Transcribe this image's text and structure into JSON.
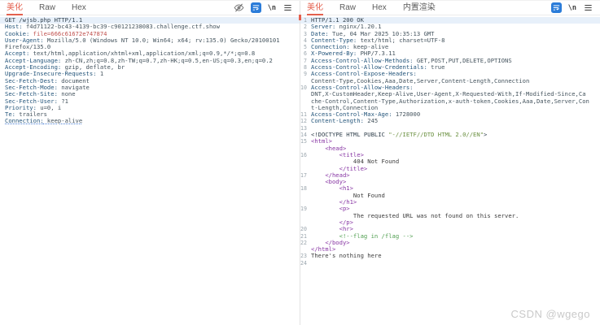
{
  "watermark": "CSDN @wgego",
  "colors": {
    "accent": "#e4604e",
    "wrap_icon_bg": "#2b7cd9",
    "line_highlight": "#e7f0fa"
  },
  "request_panel": {
    "tabs": [
      {
        "id": "pretty",
        "label": "美化",
        "active": true
      },
      {
        "id": "raw",
        "label": "Raw",
        "active": false
      },
      {
        "id": "hex",
        "label": "Hex",
        "active": false
      }
    ],
    "icons": [
      "hide-icon",
      "word-wrap-icon",
      "newline-icon",
      "menu-icon"
    ],
    "lines": [
      {
        "hl": true,
        "s": [
          [
            "GET /wjsb.php HTTP/1.1",
            "plain"
          ]
        ]
      },
      {
        "s": [
          [
            "Host:",
            "hname"
          ],
          [
            " f4d71122-bc43-4139-bc39-c90121238083.challenge.ctf.show",
            "hval"
          ]
        ]
      },
      {
        "s": [
          [
            "Cookie:",
            "hname"
          ],
          [
            " ",
            "hval"
          ],
          [
            "file=666c61672e747874",
            "red"
          ]
        ]
      },
      {
        "s": [
          [
            "User-Agent:",
            "hname"
          ],
          [
            " Mozilla/5.0 (Windows NT 10.0; Win64; x64; rv:135.0) Gecko/20100101",
            "hval"
          ]
        ]
      },
      {
        "s": [
          [
            "Firefox/135.0",
            "hval"
          ]
        ]
      },
      {
        "s": [
          [
            "Accept:",
            "hname"
          ],
          [
            " text/html,application/xhtml+xml,application/xml;q=0.9,*/*;q=0.8",
            "hval"
          ]
        ]
      },
      {
        "s": [
          [
            "Accept-Language:",
            "hname"
          ],
          [
            " zh-CN,zh;q=0.8,zh-TW;q=0.7,zh-HK;q=0.5,en-US;q=0.3,en;q=0.2",
            "hval"
          ]
        ]
      },
      {
        "s": [
          [
            "Accept-Encoding:",
            "hname"
          ],
          [
            " gzip, deflate, br",
            "hval"
          ]
        ]
      },
      {
        "s": [
          [
            "Upgrade-Insecure-Requests:",
            "hname"
          ],
          [
            " 1",
            "hval"
          ]
        ]
      },
      {
        "s": [
          [
            "Sec-Fetch-Dest:",
            "hname"
          ],
          [
            " document",
            "hval"
          ]
        ]
      },
      {
        "s": [
          [
            "Sec-Fetch-Mode:",
            "hname"
          ],
          [
            " navigate",
            "hval"
          ]
        ]
      },
      {
        "s": [
          [
            "Sec-Fetch-Site:",
            "hname"
          ],
          [
            " none",
            "hval"
          ]
        ]
      },
      {
        "s": [
          [
            "Sec-Fetch-User:",
            "hname"
          ],
          [
            " ?1",
            "hval"
          ]
        ]
      },
      {
        "s": [
          [
            "Priority:",
            "hname"
          ],
          [
            " u=0, i",
            "hval"
          ]
        ]
      },
      {
        "s": [
          [
            "Te:",
            "hname"
          ],
          [
            " trailers",
            "hval"
          ]
        ]
      },
      {
        "s": [
          [
            "Connection:",
            "uname"
          ],
          [
            " keep-alive",
            "uval"
          ]
        ]
      }
    ]
  },
  "response_panel": {
    "tabs": [
      {
        "id": "pretty",
        "label": "美化",
        "active": true
      },
      {
        "id": "raw",
        "label": "Raw",
        "active": false
      },
      {
        "id": "hex",
        "label": "Hex",
        "active": false
      },
      {
        "id": "render",
        "label": "内置渲染",
        "active": false
      }
    ],
    "icons": [
      "word-wrap-icon",
      "newline-icon",
      "menu-icon"
    ],
    "lines": [
      {
        "n": "1",
        "hl": true,
        "s": [
          [
            "HTTP/1.1 200 OK",
            "plain"
          ]
        ]
      },
      {
        "n": "2",
        "s": [
          [
            "Server:",
            "hname"
          ],
          [
            " nginx/1.20.1",
            "hval"
          ]
        ]
      },
      {
        "n": "3",
        "s": [
          [
            "Date:",
            "hname"
          ],
          [
            " Tue, 04 Mar 2025 10:35:13 GMT",
            "hval"
          ]
        ]
      },
      {
        "n": "4",
        "s": [
          [
            "Content-Type:",
            "hname"
          ],
          [
            " text/html; charset=UTF-8",
            "hval"
          ]
        ]
      },
      {
        "n": "5",
        "s": [
          [
            "Connection:",
            "hname"
          ],
          [
            " keep-alive",
            "hval"
          ]
        ]
      },
      {
        "n": "6",
        "s": [
          [
            "X-Powered-By:",
            "hname"
          ],
          [
            " PHP/7.3.11",
            "hval"
          ]
        ]
      },
      {
        "n": "7",
        "s": [
          [
            "Access-Control-Allow-Methods:",
            "hname"
          ],
          [
            " GET,POST,PUT,DELETE,OPTIONS",
            "hval"
          ]
        ]
      },
      {
        "n": "8",
        "s": [
          [
            "Access-Control-Allow-Credentials:",
            "hname"
          ],
          [
            " true",
            "hval"
          ]
        ]
      },
      {
        "n": "9",
        "s": [
          [
            "Access-Control-Expose-Headers:",
            "hname"
          ]
        ]
      },
      {
        "s": [
          [
            "Content-Type,Cookies,Aaa,Date,Server,Content-Length,Connection",
            "hval"
          ]
        ]
      },
      {
        "n": "10",
        "s": [
          [
            "Access-Control-Allow-Headers:",
            "hname"
          ]
        ]
      },
      {
        "s": [
          [
            "DNT,X-CustomHeader,Keep-Alive,User-Agent,X-Requested-With,If-Modified-Since,Ca",
            "hval"
          ]
        ]
      },
      {
        "s": [
          [
            "che-Control,Content-Type,Authorization,x-auth-token,Cookies,Aaa,Date,Server,Con",
            "hval"
          ]
        ]
      },
      {
        "s": [
          [
            "t-Length,Connection",
            "hval"
          ]
        ]
      },
      {
        "n": "11",
        "s": [
          [
            "Access-Control-Max-Age:",
            "hname"
          ],
          [
            " 1728000",
            "hval"
          ]
        ]
      },
      {
        "n": "12",
        "s": [
          [
            "Content-Length:",
            "hname"
          ],
          [
            " 245",
            "hval"
          ]
        ]
      },
      {
        "n": "13",
        "s": []
      },
      {
        "n": "14",
        "s": [
          [
            "<!DOCTYPE HTML PUBLIC ",
            "doctype"
          ],
          [
            "\"-//IETF//DTD HTML 2.0//EN\"",
            "string"
          ],
          [
            ">",
            "doctype"
          ]
        ]
      },
      {
        "n": "15",
        "s": [
          [
            "<html>",
            "tag"
          ]
        ]
      },
      {
        "s": [
          [
            "    ",
            "plain"
          ],
          [
            "<head>",
            "tag"
          ]
        ]
      },
      {
        "n": "16",
        "s": [
          [
            "        ",
            "plain"
          ],
          [
            "<title>",
            "tag"
          ]
        ]
      },
      {
        "s": [
          [
            "            404 Not Found",
            "text"
          ]
        ]
      },
      {
        "s": [
          [
            "        ",
            "plain"
          ],
          [
            "</title>",
            "tag"
          ]
        ]
      },
      {
        "n": "17",
        "s": [
          [
            "    ",
            "plain"
          ],
          [
            "</head>",
            "tag"
          ]
        ]
      },
      {
        "s": [
          [
            "    ",
            "plain"
          ],
          [
            "<body>",
            "tag"
          ]
        ]
      },
      {
        "n": "18",
        "s": [
          [
            "        ",
            "plain"
          ],
          [
            "<h1>",
            "tag"
          ]
        ]
      },
      {
        "s": [
          [
            "            Not Found",
            "text"
          ]
        ]
      },
      {
        "s": [
          [
            "        ",
            "plain"
          ],
          [
            "</h1>",
            "tag"
          ]
        ]
      },
      {
        "n": "19",
        "s": [
          [
            "        ",
            "plain"
          ],
          [
            "<p>",
            "tag"
          ]
        ]
      },
      {
        "s": [
          [
            "            The requested URL was not found on this server.",
            "text"
          ]
        ]
      },
      {
        "s": [
          [
            "        ",
            "plain"
          ],
          [
            "</p>",
            "tag"
          ]
        ]
      },
      {
        "n": "20",
        "s": [
          [
            "        ",
            "plain"
          ],
          [
            "<hr>",
            "tag"
          ]
        ]
      },
      {
        "n": "21",
        "s": [
          [
            "        ",
            "plain"
          ],
          [
            "<!--flag in /flag -->",
            "comment"
          ]
        ]
      },
      {
        "n": "22",
        "s": [
          [
            "    ",
            "plain"
          ],
          [
            "</body>",
            "tag"
          ]
        ]
      },
      {
        "s": [
          [
            "</html>",
            "tag"
          ]
        ]
      },
      {
        "n": "23",
        "s": [
          [
            "There's nothing here",
            "text"
          ]
        ]
      },
      {
        "n": "24",
        "s": []
      }
    ]
  }
}
